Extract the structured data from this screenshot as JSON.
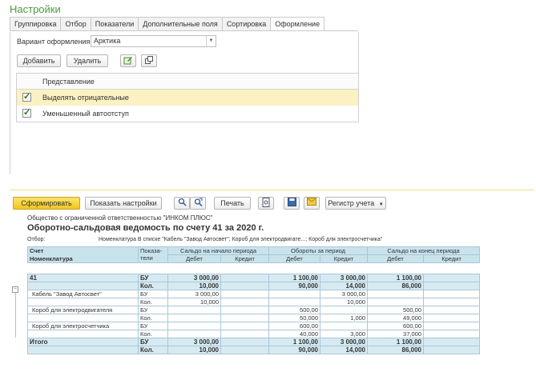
{
  "title": "Настройки",
  "tabs": [
    "Группировка",
    "Отбор",
    "Показатели",
    "Дополнительные поля",
    "Сортировка",
    "Оформление"
  ],
  "variant": {
    "label": "Вариант оформления:",
    "value": "Арктика"
  },
  "toolbar1": {
    "add": "Добавить",
    "delete": "Удалить"
  },
  "grid": {
    "header": "Представление",
    "rows": [
      {
        "label": "Выделять отрицательные",
        "checked": true
      },
      {
        "label": "Уменьшенный автоотступ",
        "checked": true
      }
    ]
  },
  "toolbar2": {
    "generate": "Сформировать",
    "show_settings": "Показать настройки",
    "print": "Печать",
    "register": "Регистр учета"
  },
  "report": {
    "org": "Общество с ограниченной ответственностью \"ИНКОМ ПЛЮС\"",
    "title": "Оборотно-сальдовая ведомость по счету 41 за 2020 г.",
    "filter_label": "Отбор:",
    "filter_value": "Номенклатура В списке \"Кабель \"Завод Автосвет\"; Короб для электродвигате...; Короб для электросчетчика\"",
    "headers": {
      "account": "Счет",
      "nomenclature": "Номенклатура",
      "indicators": "Показа-тели",
      "opening": "Сальдо на начало периода",
      "turnover": "Обороты за период",
      "closing": "Сальдо на конец периода",
      "debit": "Дебет",
      "credit": "Кредит"
    },
    "rows": [
      {
        "name": "41",
        "type": "БУ",
        "od": "3 000,00",
        "oc": "",
        "td": "1 100,00",
        "tc": "3 000,00",
        "cd": "1 100,00",
        "cc": "",
        "style": "grp"
      },
      {
        "name": "",
        "type": "Кол.",
        "od": "10,000",
        "oc": "",
        "td": "90,000",
        "tc": "14,000",
        "cd": "86,000",
        "cc": "",
        "style": "grp"
      },
      {
        "name": "Кабель \"Завод Автосвет\"",
        "type": "БУ",
        "od": "3 000,00",
        "oc": "",
        "td": "",
        "tc": "3 000,00",
        "cd": "",
        "cc": "",
        "style": ""
      },
      {
        "name": "",
        "type": "Кол.",
        "od": "10,000",
        "oc": "",
        "td": "",
        "tc": "10,000",
        "cd": "",
        "cc": "",
        "style": ""
      },
      {
        "name": "Короб для электродвигателя",
        "type": "БУ",
        "od": "",
        "oc": "",
        "td": "500,00",
        "tc": "",
        "cd": "500,00",
        "cc": "",
        "style": ""
      },
      {
        "name": "",
        "type": "Кол.",
        "od": "",
        "oc": "",
        "td": "50,000",
        "tc": "1,000",
        "cd": "49,000",
        "cc": "",
        "style": ""
      },
      {
        "name": "Короб для электросчетчика",
        "type": "БУ",
        "od": "",
        "oc": "",
        "td": "600,00",
        "tc": "",
        "cd": "600,00",
        "cc": "",
        "style": ""
      },
      {
        "name": "",
        "type": "Кол.",
        "od": "",
        "oc": "",
        "td": "40,000",
        "tc": "3,000",
        "cd": "37,000",
        "cc": "",
        "style": ""
      },
      {
        "name": "Итого",
        "type": "БУ",
        "od": "3 000,00",
        "oc": "",
        "td": "1 100,00",
        "tc": "3 000,00",
        "cd": "1 100,00",
        "cc": "",
        "style": "tot"
      },
      {
        "name": "",
        "type": "Кол.",
        "od": "10,000",
        "oc": "",
        "td": "90,000",
        "tc": "14,000",
        "cd": "86,000",
        "cc": "",
        "style": "tot"
      }
    ]
  }
}
